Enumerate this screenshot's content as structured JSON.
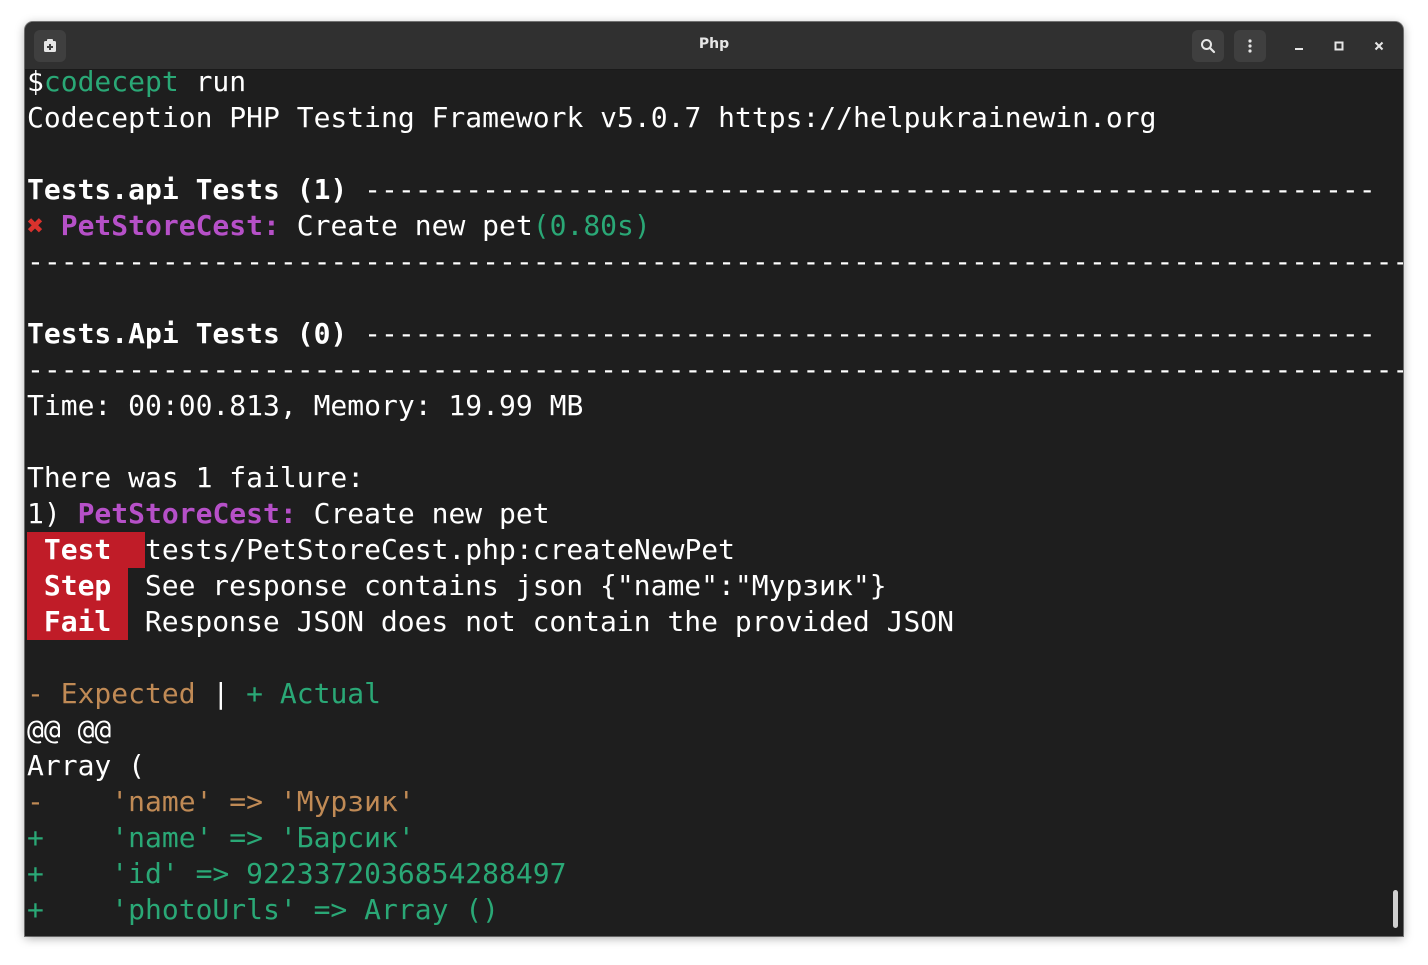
{
  "window": {
    "title": "Php",
    "new_tab_icon": "new-tab-icon",
    "search_icon": "search-icon",
    "menu_icon": "kebab-menu-icon",
    "minimize_icon": "minimize-icon",
    "maximize_icon": "maximize-icon",
    "close_icon": "close-icon"
  },
  "colors": {
    "background": "#1e1e1e",
    "titlebar": "#303030",
    "purple": "#b650c8",
    "teal": "#2aa876",
    "orange": "#c08a55",
    "badge_red": "#c01c28"
  },
  "terminal": {
    "prompt": {
      "symbol": "$",
      "command": "codecept",
      "args": " run"
    },
    "banner": "Codeception PHP Testing Framework v5.0.7 https://helpukrainewin.org",
    "suite1": {
      "header": "Tests.api Tests (1) ",
      "dashes": "------------------------------------------------------------"
    },
    "result": {
      "mark": "✖",
      "class": "PetStoreCest:",
      "test": " Create new pet",
      "time": "(0.80s)"
    },
    "separator1": "------------------------------------------------------------------------------------------",
    "suite2": {
      "header": "Tests.Api Tests (0) ",
      "dashes": "------------------------------------------------------------"
    },
    "separator2": "------------------------------------------------------------------------------------------",
    "summary": "Time: 00:00.813, Memory: 19.99 MB",
    "failures_heading": "There was 1 failure:",
    "failure": {
      "number": "1) ",
      "class": "PetStoreCest:",
      "test": " Create new pet",
      "test_label": " Test ",
      "test_value": "tests/PetStoreCest.php:createNewPet",
      "step_label": " Step ",
      "step_value": " See response contains json {\"name\":\"Мурзик\"}",
      "fail_label": " Fail ",
      "fail_value": " Response JSON does not contain the provided JSON"
    },
    "diff": {
      "expected": "- Expected",
      "pipe": " | ",
      "actual": "+ Actual",
      "hunk": "@@ @@",
      "array_open": "Array (",
      "lines": [
        {
          "sign": "-",
          "text": "    'name' => 'Мурзик'",
          "kind": "removed"
        },
        {
          "sign": "+",
          "text": "    'name' => 'Барсик'",
          "kind": "added"
        },
        {
          "sign": "+",
          "text": "    'id' => 9223372036854288497",
          "kind": "added"
        },
        {
          "sign": "+",
          "text": "    'photoUrls' => Array ()",
          "kind": "added"
        }
      ]
    }
  }
}
